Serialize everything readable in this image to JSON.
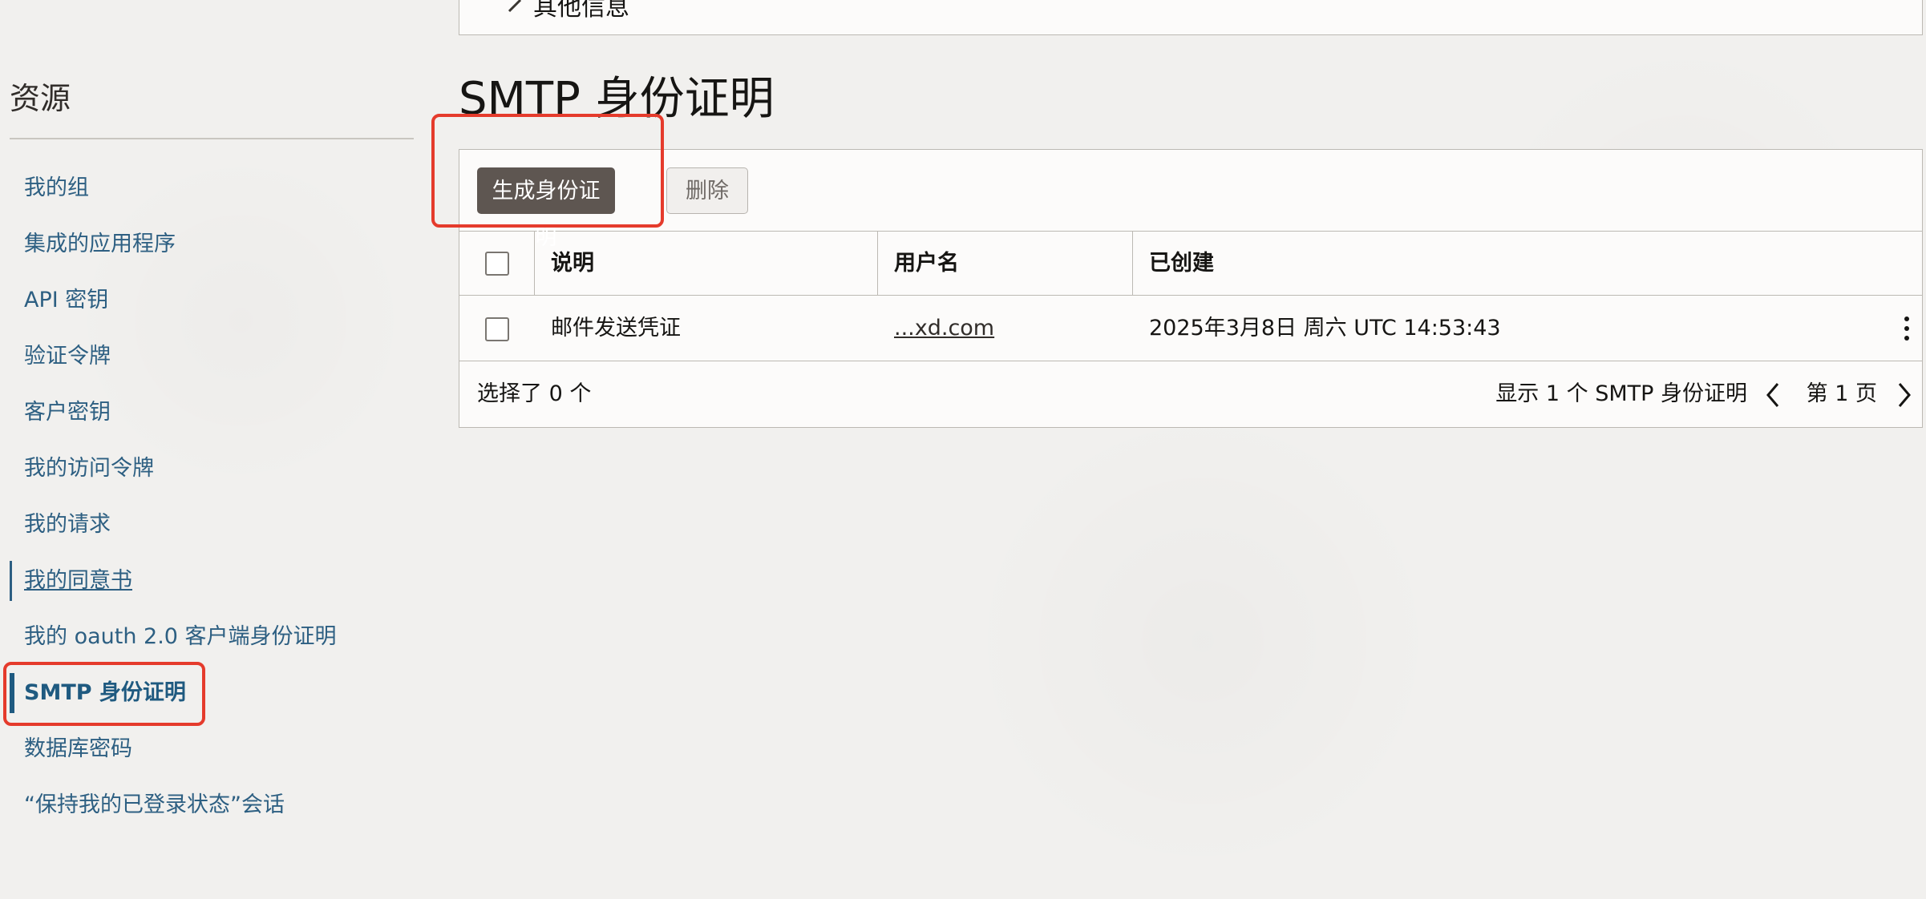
{
  "top_panel": {
    "label": "其他信息"
  },
  "sidebar": {
    "title": "资源",
    "items": [
      {
        "label": "我的组"
      },
      {
        "label": "集成的应用程序"
      },
      {
        "label": "API 密钥"
      },
      {
        "label": "验证令牌"
      },
      {
        "label": "客户密钥"
      },
      {
        "label": "我的访问令牌"
      },
      {
        "label": "我的请求"
      },
      {
        "label": "我的同意书"
      },
      {
        "label": "我的 oauth 2.0 客户端身份证明"
      },
      {
        "label": "SMTP 身份证明",
        "active": true
      },
      {
        "label": "数据库密码"
      },
      {
        "label": "“保持我的已登录状态”会话"
      }
    ]
  },
  "main": {
    "title": "SMTP 身份证明",
    "toolbar": {
      "generate_label": "生成身份证明",
      "delete_label": "删除"
    },
    "table": {
      "columns": [
        "说明",
        "用户名",
        "已创建"
      ],
      "rows": [
        {
          "description": "邮件发送凭证",
          "username": "...xd.com",
          "created": "2025年3月8日 周六 UTC 14:53:43"
        }
      ]
    },
    "footer": {
      "selected": "选择了 0 个",
      "summary": "显示 1 个 SMTP 身份证明",
      "page": "第 1 页"
    }
  },
  "colors": {
    "link": "#2d5f82",
    "primary_button": "#5e5651",
    "highlight": "#e53b2c",
    "background": "#f1f0ee"
  },
  "icons": {
    "collapse": "chevron-right-icon",
    "row_actions": "kebab-menu-icon",
    "prev_page": "chevron-left-icon",
    "next_page": "chevron-right-icon"
  }
}
